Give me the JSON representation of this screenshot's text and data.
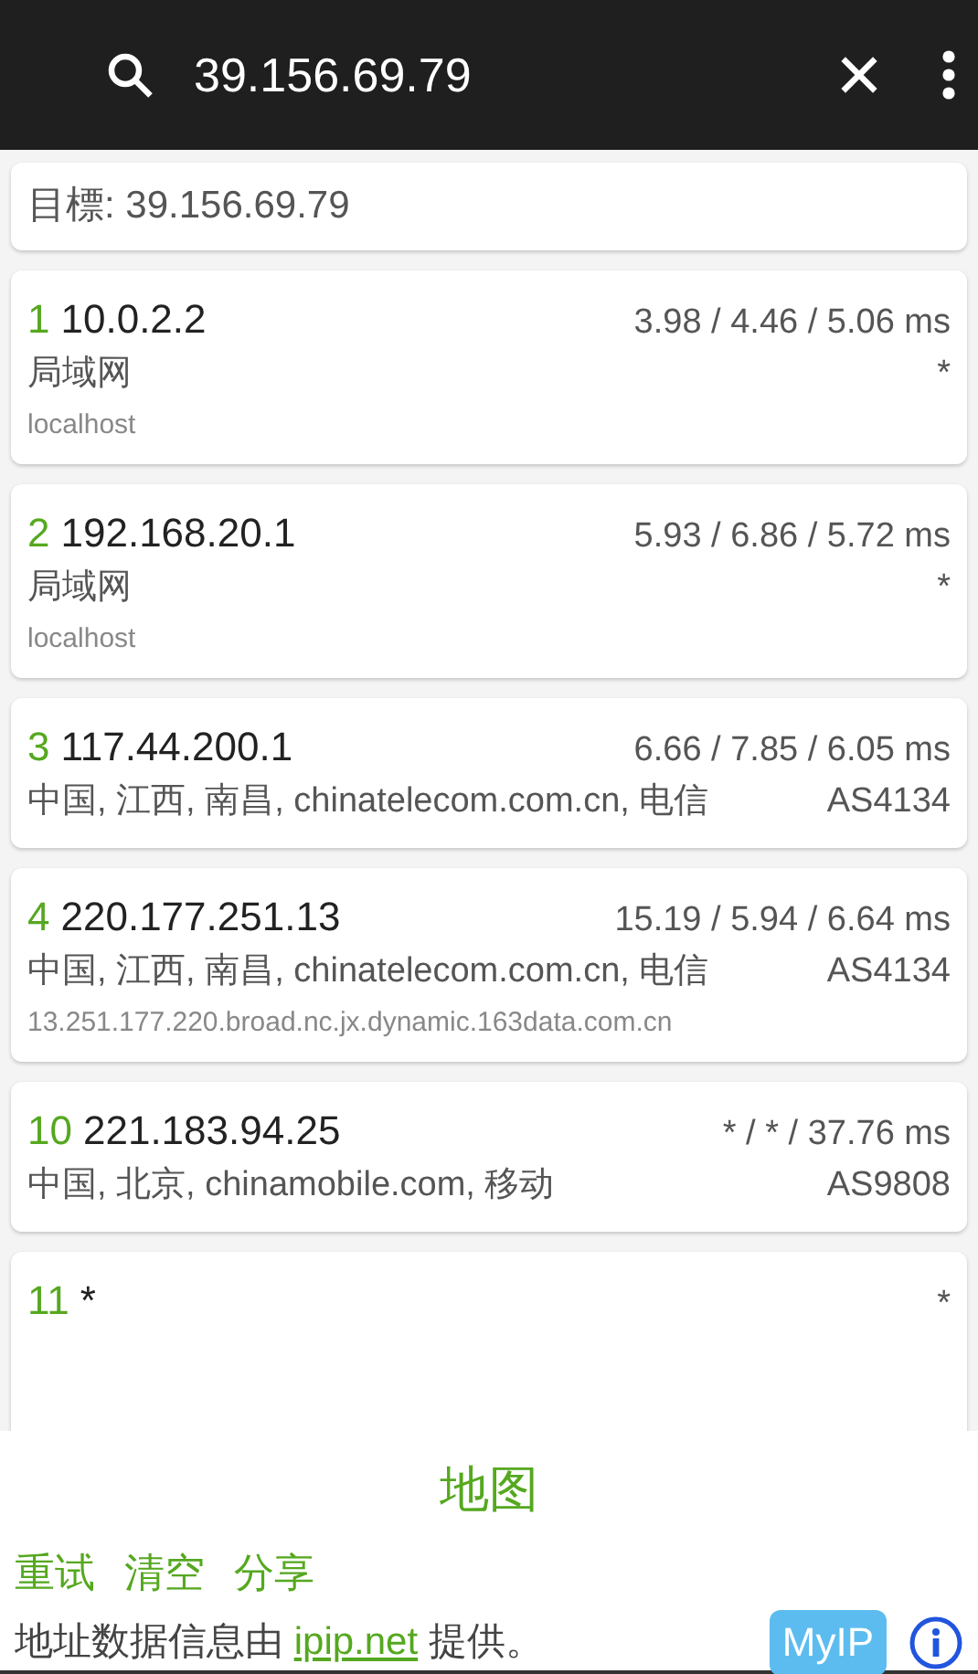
{
  "search": {
    "value": "39.156.69.79"
  },
  "target": "目標: 39.156.69.79",
  "hops": [
    {
      "number": "1",
      "ip": "10.0.2.2",
      "times": "3.98 / 4.46 / 5.06 ms",
      "location": "局域网",
      "asn": "*",
      "host": "localhost"
    },
    {
      "number": "2",
      "ip": "192.168.20.1",
      "times": "5.93 / 6.86 / 5.72 ms",
      "location": "局域网",
      "asn": "*",
      "host": "localhost"
    },
    {
      "number": "3",
      "ip": "117.44.200.1",
      "times": "6.66 / 7.85 / 6.05 ms",
      "location": "中国, 江西, 南昌, chinatelecom.com.cn, 电信",
      "asn": "AS4134"
    },
    {
      "number": "4",
      "ip": "220.177.251.13",
      "times": "15.19 / 5.94 / 6.64 ms",
      "location": "中国, 江西, 南昌, chinatelecom.com.cn, 电信",
      "asn": "AS4134",
      "host": "13.251.177.220.broad.nc.jx.dynamic.163data.com.cn"
    },
    {
      "number": "10",
      "ip": "221.183.94.25",
      "times": "* / * / 37.76 ms",
      "location": "中国, 北京, chinamobile.com, 移动",
      "asn": "AS9808"
    },
    {
      "number": "11",
      "ip": "*",
      "times": "*"
    }
  ],
  "map_button": "地图",
  "actions": [
    "重试",
    "清空",
    "分享"
  ],
  "credit": {
    "before": "地址数据信息由",
    "link": "ipip.net",
    "after": "提供。"
  },
  "myip_button": "MyIP"
}
